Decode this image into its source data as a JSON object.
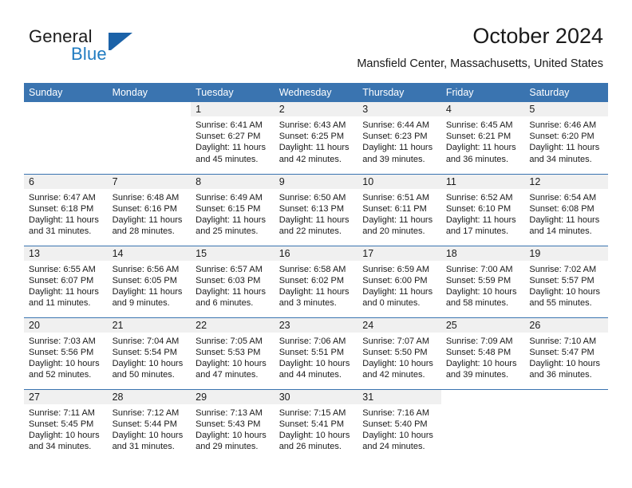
{
  "brand": {
    "word1": "General",
    "word2": "Blue",
    "flag_icon": "blue-flag-logo-icon"
  },
  "header": {
    "title": "October 2024",
    "subtitle": "Mansfield Center, Massachusetts, United States"
  },
  "theme": {
    "header_blue": "#3a74b0",
    "brand_blue": "#1f7bc1",
    "daynum_gray": "#f0f0f0",
    "text": "#1a1a1a"
  },
  "weekday_headers": [
    "Sunday",
    "Monday",
    "Tuesday",
    "Wednesday",
    "Thursday",
    "Friday",
    "Saturday"
  ],
  "weeks": [
    [
      {
        "day": "",
        "sunrise": "",
        "sunset": "",
        "daylight_line1": "",
        "daylight_line2": "",
        "blank": true
      },
      {
        "day": "",
        "sunrise": "",
        "sunset": "",
        "daylight_line1": "",
        "daylight_line2": "",
        "blank": true
      },
      {
        "day": "1",
        "sunrise": "Sunrise: 6:41 AM",
        "sunset": "Sunset: 6:27 PM",
        "daylight_line1": "Daylight: 11 hours",
        "daylight_line2": "and 45 minutes."
      },
      {
        "day": "2",
        "sunrise": "Sunrise: 6:43 AM",
        "sunset": "Sunset: 6:25 PM",
        "daylight_line1": "Daylight: 11 hours",
        "daylight_line2": "and 42 minutes."
      },
      {
        "day": "3",
        "sunrise": "Sunrise: 6:44 AM",
        "sunset": "Sunset: 6:23 PM",
        "daylight_line1": "Daylight: 11 hours",
        "daylight_line2": "and 39 minutes."
      },
      {
        "day": "4",
        "sunrise": "Sunrise: 6:45 AM",
        "sunset": "Sunset: 6:21 PM",
        "daylight_line1": "Daylight: 11 hours",
        "daylight_line2": "and 36 minutes."
      },
      {
        "day": "5",
        "sunrise": "Sunrise: 6:46 AM",
        "sunset": "Sunset: 6:20 PM",
        "daylight_line1": "Daylight: 11 hours",
        "daylight_line2": "and 34 minutes."
      }
    ],
    [
      {
        "day": "6",
        "sunrise": "Sunrise: 6:47 AM",
        "sunset": "Sunset: 6:18 PM",
        "daylight_line1": "Daylight: 11 hours",
        "daylight_line2": "and 31 minutes."
      },
      {
        "day": "7",
        "sunrise": "Sunrise: 6:48 AM",
        "sunset": "Sunset: 6:16 PM",
        "daylight_line1": "Daylight: 11 hours",
        "daylight_line2": "and 28 minutes."
      },
      {
        "day": "8",
        "sunrise": "Sunrise: 6:49 AM",
        "sunset": "Sunset: 6:15 PM",
        "daylight_line1": "Daylight: 11 hours",
        "daylight_line2": "and 25 minutes."
      },
      {
        "day": "9",
        "sunrise": "Sunrise: 6:50 AM",
        "sunset": "Sunset: 6:13 PM",
        "daylight_line1": "Daylight: 11 hours",
        "daylight_line2": "and 22 minutes."
      },
      {
        "day": "10",
        "sunrise": "Sunrise: 6:51 AM",
        "sunset": "Sunset: 6:11 PM",
        "daylight_line1": "Daylight: 11 hours",
        "daylight_line2": "and 20 minutes."
      },
      {
        "day": "11",
        "sunrise": "Sunrise: 6:52 AM",
        "sunset": "Sunset: 6:10 PM",
        "daylight_line1": "Daylight: 11 hours",
        "daylight_line2": "and 17 minutes."
      },
      {
        "day": "12",
        "sunrise": "Sunrise: 6:54 AM",
        "sunset": "Sunset: 6:08 PM",
        "daylight_line1": "Daylight: 11 hours",
        "daylight_line2": "and 14 minutes."
      }
    ],
    [
      {
        "day": "13",
        "sunrise": "Sunrise: 6:55 AM",
        "sunset": "Sunset: 6:07 PM",
        "daylight_line1": "Daylight: 11 hours",
        "daylight_line2": "and 11 minutes."
      },
      {
        "day": "14",
        "sunrise": "Sunrise: 6:56 AM",
        "sunset": "Sunset: 6:05 PM",
        "daylight_line1": "Daylight: 11 hours",
        "daylight_line2": "and 9 minutes."
      },
      {
        "day": "15",
        "sunrise": "Sunrise: 6:57 AM",
        "sunset": "Sunset: 6:03 PM",
        "daylight_line1": "Daylight: 11 hours",
        "daylight_line2": "and 6 minutes."
      },
      {
        "day": "16",
        "sunrise": "Sunrise: 6:58 AM",
        "sunset": "Sunset: 6:02 PM",
        "daylight_line1": "Daylight: 11 hours",
        "daylight_line2": "and 3 minutes."
      },
      {
        "day": "17",
        "sunrise": "Sunrise: 6:59 AM",
        "sunset": "Sunset: 6:00 PM",
        "daylight_line1": "Daylight: 11 hours",
        "daylight_line2": "and 0 minutes."
      },
      {
        "day": "18",
        "sunrise": "Sunrise: 7:00 AM",
        "sunset": "Sunset: 5:59 PM",
        "daylight_line1": "Daylight: 10 hours",
        "daylight_line2": "and 58 minutes."
      },
      {
        "day": "19",
        "sunrise": "Sunrise: 7:02 AM",
        "sunset": "Sunset: 5:57 PM",
        "daylight_line1": "Daylight: 10 hours",
        "daylight_line2": "and 55 minutes."
      }
    ],
    [
      {
        "day": "20",
        "sunrise": "Sunrise: 7:03 AM",
        "sunset": "Sunset: 5:56 PM",
        "daylight_line1": "Daylight: 10 hours",
        "daylight_line2": "and 52 minutes."
      },
      {
        "day": "21",
        "sunrise": "Sunrise: 7:04 AM",
        "sunset": "Sunset: 5:54 PM",
        "daylight_line1": "Daylight: 10 hours",
        "daylight_line2": "and 50 minutes."
      },
      {
        "day": "22",
        "sunrise": "Sunrise: 7:05 AM",
        "sunset": "Sunset: 5:53 PM",
        "daylight_line1": "Daylight: 10 hours",
        "daylight_line2": "and 47 minutes."
      },
      {
        "day": "23",
        "sunrise": "Sunrise: 7:06 AM",
        "sunset": "Sunset: 5:51 PM",
        "daylight_line1": "Daylight: 10 hours",
        "daylight_line2": "and 44 minutes."
      },
      {
        "day": "24",
        "sunrise": "Sunrise: 7:07 AM",
        "sunset": "Sunset: 5:50 PM",
        "daylight_line1": "Daylight: 10 hours",
        "daylight_line2": "and 42 minutes."
      },
      {
        "day": "25",
        "sunrise": "Sunrise: 7:09 AM",
        "sunset": "Sunset: 5:48 PM",
        "daylight_line1": "Daylight: 10 hours",
        "daylight_line2": "and 39 minutes."
      },
      {
        "day": "26",
        "sunrise": "Sunrise: 7:10 AM",
        "sunset": "Sunset: 5:47 PM",
        "daylight_line1": "Daylight: 10 hours",
        "daylight_line2": "and 36 minutes."
      }
    ],
    [
      {
        "day": "27",
        "sunrise": "Sunrise: 7:11 AM",
        "sunset": "Sunset: 5:45 PM",
        "daylight_line1": "Daylight: 10 hours",
        "daylight_line2": "and 34 minutes."
      },
      {
        "day": "28",
        "sunrise": "Sunrise: 7:12 AM",
        "sunset": "Sunset: 5:44 PM",
        "daylight_line1": "Daylight: 10 hours",
        "daylight_line2": "and 31 minutes."
      },
      {
        "day": "29",
        "sunrise": "Sunrise: 7:13 AM",
        "sunset": "Sunset: 5:43 PM",
        "daylight_line1": "Daylight: 10 hours",
        "daylight_line2": "and 29 minutes."
      },
      {
        "day": "30",
        "sunrise": "Sunrise: 7:15 AM",
        "sunset": "Sunset: 5:41 PM",
        "daylight_line1": "Daylight: 10 hours",
        "daylight_line2": "and 26 minutes."
      },
      {
        "day": "31",
        "sunrise": "Sunrise: 7:16 AM",
        "sunset": "Sunset: 5:40 PM",
        "daylight_line1": "Daylight: 10 hours",
        "daylight_line2": "and 24 minutes."
      },
      {
        "day": "",
        "sunrise": "",
        "sunset": "",
        "daylight_line1": "",
        "daylight_line2": "",
        "blank": true
      },
      {
        "day": "",
        "sunrise": "",
        "sunset": "",
        "daylight_line1": "",
        "daylight_line2": "",
        "blank": true
      }
    ]
  ]
}
